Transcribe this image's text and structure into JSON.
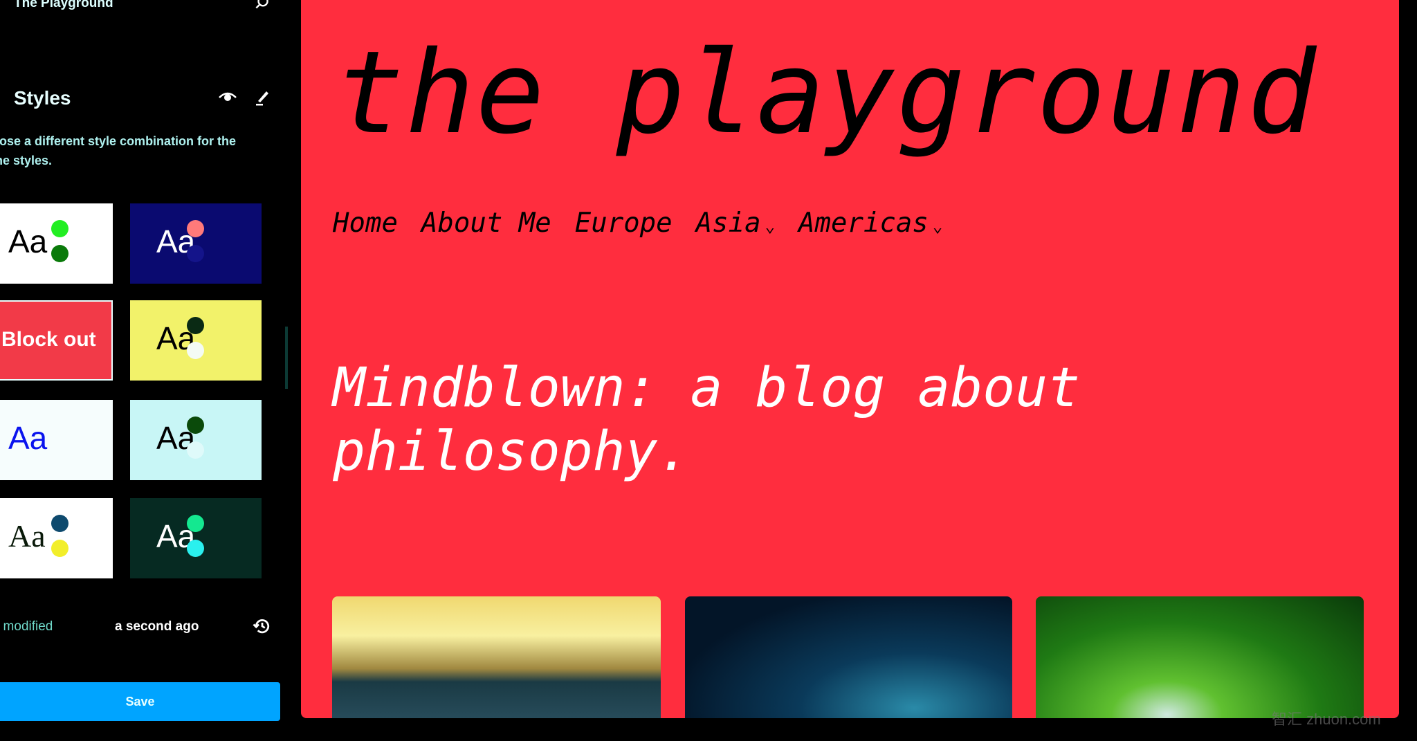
{
  "sidebar": {
    "site_title": "The Playground",
    "styles_title": "Styles",
    "description": "oose a different style combination for the me styles.",
    "cards": [
      {
        "label": "Aa",
        "bg": "#ffffff",
        "fg": "#000000",
        "dots": [
          "#22ee22",
          "#0a7a0a"
        ]
      },
      {
        "label": "Aa",
        "bg": "#0a0a70",
        "fg": "#ffffff",
        "dots": [
          "#ff7a7a",
          "#14148a"
        ]
      },
      {
        "label": "Block out",
        "bg": "#f23a48",
        "fg": "#ffffff",
        "dots": [],
        "selected": true
      },
      {
        "label": "Aa",
        "bg": "#f2f26a",
        "fg": "#000000",
        "dots": [
          "#0a2a14",
          "#f4fbf4"
        ]
      },
      {
        "label": "Aa",
        "bg": "#f6fdfd",
        "fg": "#0a14ee",
        "dots": []
      },
      {
        "label": "Aa",
        "bg": "#c8f6f6",
        "fg": "#000000",
        "dots": [
          "#0a4a0a",
          "#dffafa"
        ]
      },
      {
        "label": "Aa",
        "bg": "#ffffff",
        "fg": "#0a1a0a",
        "dots": [
          "#0e4a6e",
          "#f2ee2a"
        ],
        "serif": true
      },
      {
        "label": "Aa",
        "bg": "#062a22",
        "fg": "#ffffff",
        "dots": [
          "#14e890",
          "#2af0ee"
        ]
      }
    ],
    "last_modified_label": "t modified",
    "last_modified_value": "a second ago",
    "save_label": "Save"
  },
  "main": {
    "site_title": "the playground",
    "nav": [
      {
        "label": "Home"
      },
      {
        "label": "About Me"
      },
      {
        "label": "Europe"
      },
      {
        "label": "Asia",
        "has_submenu": true
      },
      {
        "label": "Americas",
        "has_submenu": true
      }
    ],
    "headline": "Mindblown: a blog about philosophy.",
    "background": "#ff2d3e"
  },
  "watermark": "智汇 zhuon.com"
}
